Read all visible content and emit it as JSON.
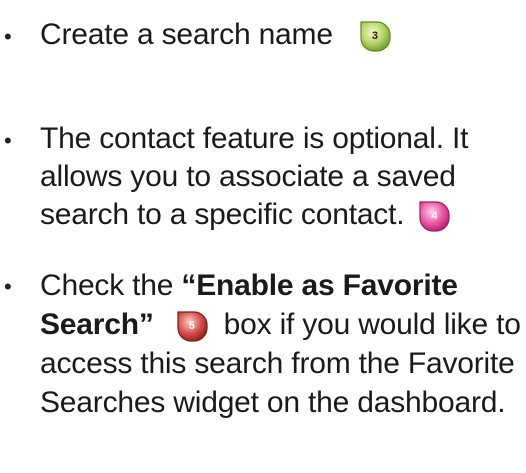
{
  "bullets": [
    {
      "text_a": "Create a search name",
      "badge": "3",
      "badge_color": "#8fc23a"
    },
    {
      "text_a": "The contact feature is optional. It allows you to associate a saved search to a specific contact.",
      "badge": "4",
      "badge_color": "#e0459b"
    },
    {
      "text_pre": "Check the ",
      "text_bold_1": "“Enable as Favorite",
      "text_bold_2": "Search”",
      "badge": "5",
      "badge_color": "#c0392b",
      "text_post": "box if you would like to access this search from the Favorite Searches widget on the dashboard."
    }
  ],
  "bullet_glyph": "•"
}
